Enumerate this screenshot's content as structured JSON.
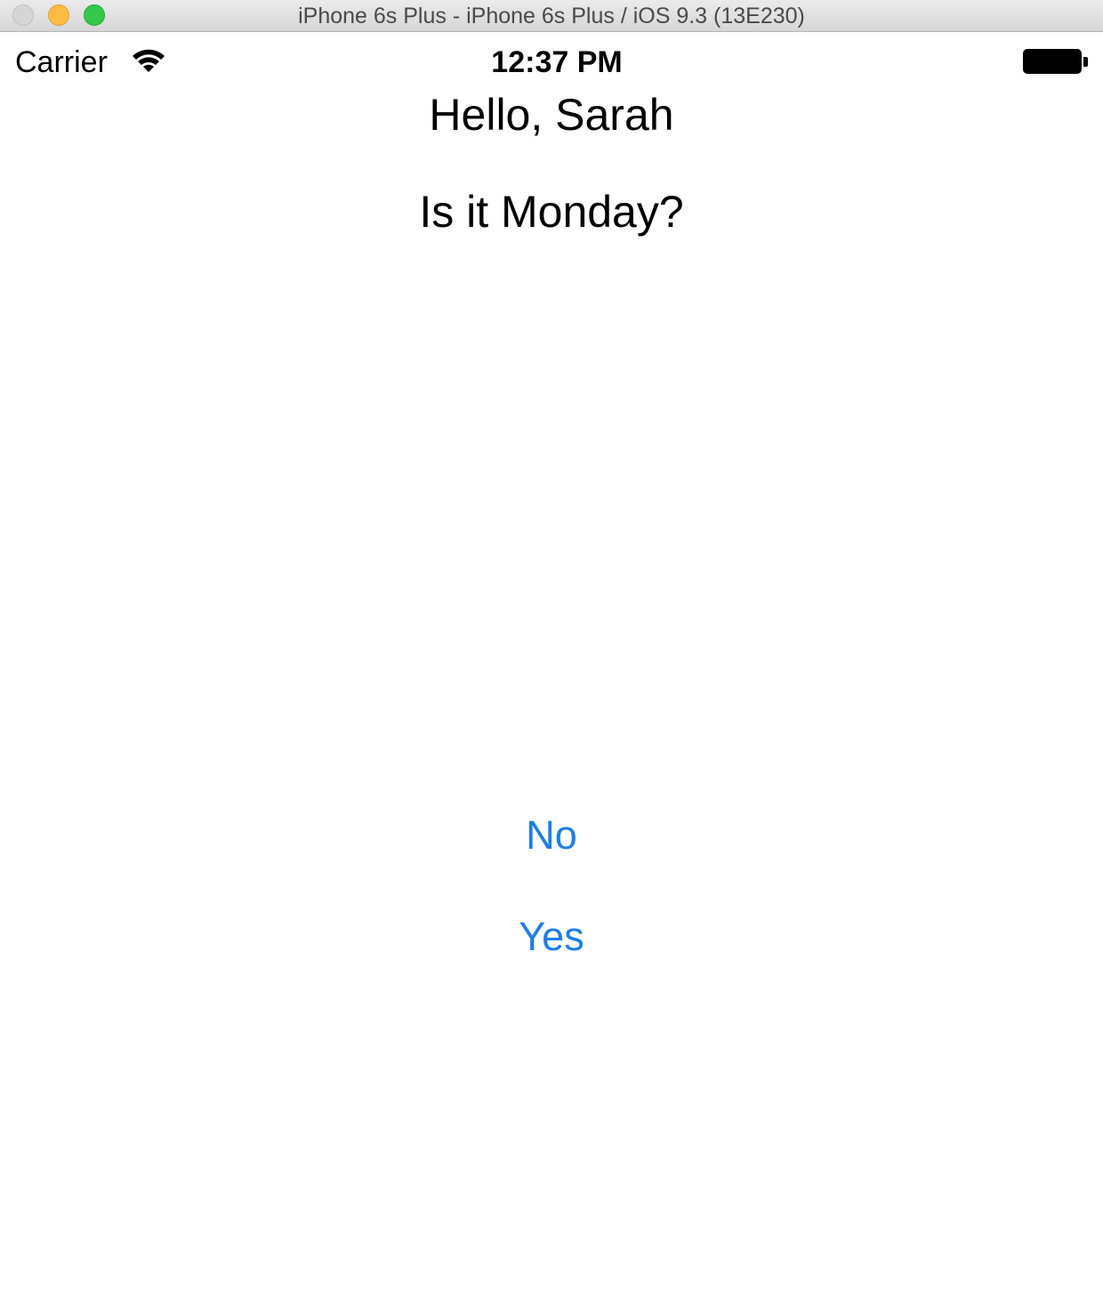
{
  "window": {
    "title": "iPhone 6s Plus - iPhone 6s Plus / iOS 9.3 (13E230)"
  },
  "status_bar": {
    "carrier": "Carrier",
    "wifi_icon": "wifi-icon",
    "time": "12:37 PM",
    "battery_icon": "battery-full-icon",
    "battery_level": 1.0
  },
  "content": {
    "greeting": "Hello, Sarah",
    "question": "Is it Monday?"
  },
  "buttons": {
    "no_label": "No",
    "yes_label": "Yes"
  },
  "colors": {
    "accent": "#1a7ef0",
    "traffic_close": "#d5d5d5",
    "traffic_minimize": "#fdbc40",
    "traffic_maximize": "#34c84a"
  }
}
